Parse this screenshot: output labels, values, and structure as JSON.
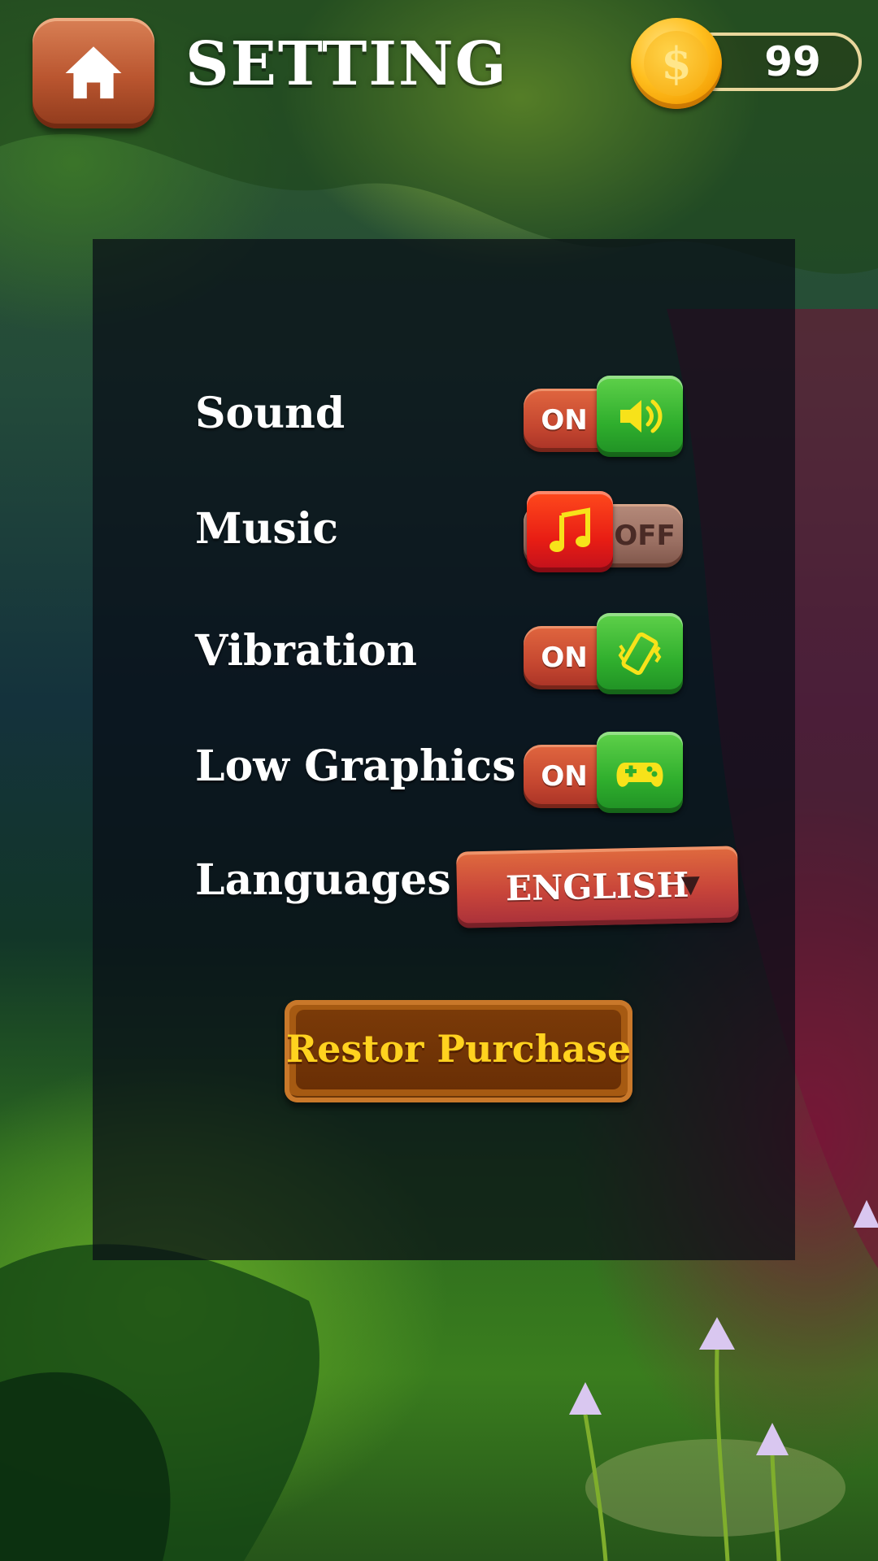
{
  "header": {
    "title": "SETTING",
    "coins": "99"
  },
  "settings": [
    {
      "label": "Sound",
      "state": "ON",
      "icon": "speaker-icon"
    },
    {
      "label": "Music",
      "state": "OFF",
      "icon": "music-note-icon"
    },
    {
      "label": "Vibration",
      "state": "ON",
      "icon": "vibration-phone-icon"
    },
    {
      "label": "Low Graphics",
      "state": "ON",
      "icon": "gamepad-icon"
    }
  ],
  "language": {
    "label": "Languages",
    "value": "ENGLISH",
    "caret": "▼"
  },
  "restore": {
    "label": "Restor Purchase"
  },
  "colors": {
    "on_knob": "#2fae2d",
    "off_knob": "#e81d14",
    "button_text": "#ffd21f"
  }
}
